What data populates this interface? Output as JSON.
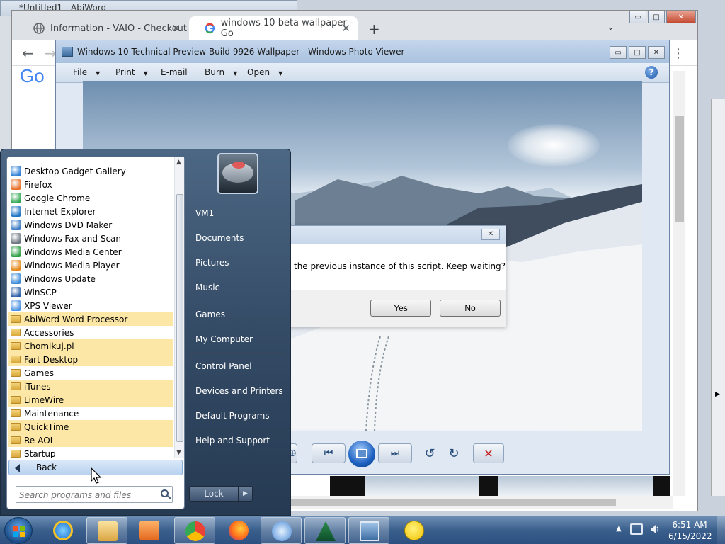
{
  "abiword": {
    "title": "*Untitled1 - AbiWord"
  },
  "chrome": {
    "tabs": [
      {
        "label": "Information - VAIO - Checkout"
      },
      {
        "label": "windows 10 beta wallpaper - Go"
      }
    ],
    "logo_text": "Go"
  },
  "photo_viewer": {
    "title": "Windows 10 Technical Preview Build 9926 Wallpaper - Windows Photo Viewer",
    "menu": {
      "file": "File",
      "print": "Print",
      "email": "E-mail",
      "burn": "Burn",
      "open": "Open"
    }
  },
  "dialog": {
    "message": "the previous instance of this script.  Keep waiting?",
    "yes": "Yes",
    "no": "No"
  },
  "start_menu": {
    "programs": [
      {
        "label": "Desktop Gadget Gallery",
        "kind": "app",
        "highlight": false
      },
      {
        "label": "Firefox",
        "kind": "app",
        "highlight": false
      },
      {
        "label": "Google Chrome",
        "kind": "app",
        "highlight": false
      },
      {
        "label": "Internet Explorer",
        "kind": "app",
        "highlight": false
      },
      {
        "label": "Windows DVD Maker",
        "kind": "app",
        "highlight": false
      },
      {
        "label": "Windows Fax and Scan",
        "kind": "app",
        "highlight": false
      },
      {
        "label": "Windows Media Center",
        "kind": "app",
        "highlight": false
      },
      {
        "label": "Windows Media Player",
        "kind": "app",
        "highlight": false
      },
      {
        "label": "Windows Update",
        "kind": "app",
        "highlight": false
      },
      {
        "label": "WinSCP",
        "kind": "app",
        "highlight": false
      },
      {
        "label": "XPS Viewer",
        "kind": "app",
        "highlight": false
      },
      {
        "label": "AbiWord Word Processor",
        "kind": "folder",
        "highlight": true
      },
      {
        "label": "Accessories",
        "kind": "folder",
        "highlight": false
      },
      {
        "label": "Chomikuj.pl",
        "kind": "folder",
        "highlight": true
      },
      {
        "label": "Fart Desktop",
        "kind": "folder",
        "highlight": true
      },
      {
        "label": "Games",
        "kind": "folder",
        "highlight": false
      },
      {
        "label": "iTunes",
        "kind": "folder",
        "highlight": true
      },
      {
        "label": "LimeWire",
        "kind": "folder",
        "highlight": true
      },
      {
        "label": "Maintenance",
        "kind": "folder",
        "highlight": false
      },
      {
        "label": "QuickTime",
        "kind": "folder",
        "highlight": true
      },
      {
        "label": "Re-AOL",
        "kind": "folder",
        "highlight": true
      },
      {
        "label": "Startup",
        "kind": "folder",
        "highlight": false
      }
    ],
    "back_label": "Back",
    "search_placeholder": "Search programs and files",
    "right_items": {
      "user": "VM1",
      "documents": "Documents",
      "pictures": "Pictures",
      "music": "Music",
      "games": "Games",
      "computer": "My Computer",
      "control_panel": "Control Panel",
      "devices": "Devices and Printers",
      "defaults": "Default Programs",
      "help": "Help and Support"
    },
    "lock_label": "Lock"
  },
  "taskbar": {
    "time": "6:51 AM",
    "date": "6/15/2022"
  },
  "colors": {
    "highlight": "#fce7a6",
    "start_menu_bg": "#344b66",
    "taskbar": "#3a5f8c"
  }
}
